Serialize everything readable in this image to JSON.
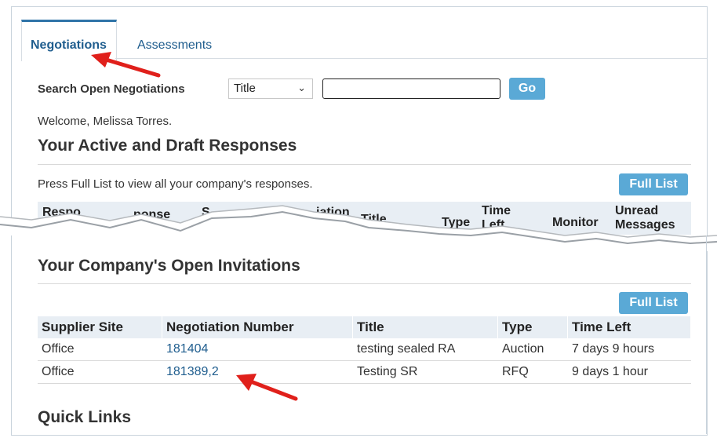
{
  "tabs": [
    {
      "label": "Negotiations",
      "active": true
    },
    {
      "label": "Assessments",
      "active": false
    }
  ],
  "search": {
    "label": "Search Open Negotiations",
    "field_value": "Title",
    "input_value": "",
    "go_label": "Go"
  },
  "welcome": "Welcome, Melissa Torres.",
  "active_responses": {
    "title": "Your Active and Draft Responses",
    "instruction": "Press Full List to view all your company's responses.",
    "full_list_label": "Full List",
    "headers_visible": [
      "Respo",
      "ponse",
      "S",
      "iation",
      "Title",
      "Type",
      "Time Left",
      "Monitor",
      "Unread Messages"
    ]
  },
  "invitations": {
    "title": "Your Company's Open Invitations",
    "full_list_label": "Full List",
    "columns": [
      "Supplier Site",
      "Negotiation Number",
      "Title",
      "Type",
      "Time Left"
    ],
    "rows": [
      {
        "site": "Office",
        "number": "181404",
        "title": "testing sealed RA",
        "type": "Auction",
        "time_left": "7 days 9 hours"
      },
      {
        "site": "Office",
        "number": "181389,2",
        "title": "Testing SR",
        "type": "RFQ",
        "time_left": "9 days 1 hour"
      }
    ]
  },
  "quick_links": {
    "title": "Quick Links"
  },
  "colors": {
    "accent": "#5aa9d6",
    "link": "#1f5d8e",
    "header_bg": "#e8eef4",
    "arrow": "#e0201b"
  }
}
